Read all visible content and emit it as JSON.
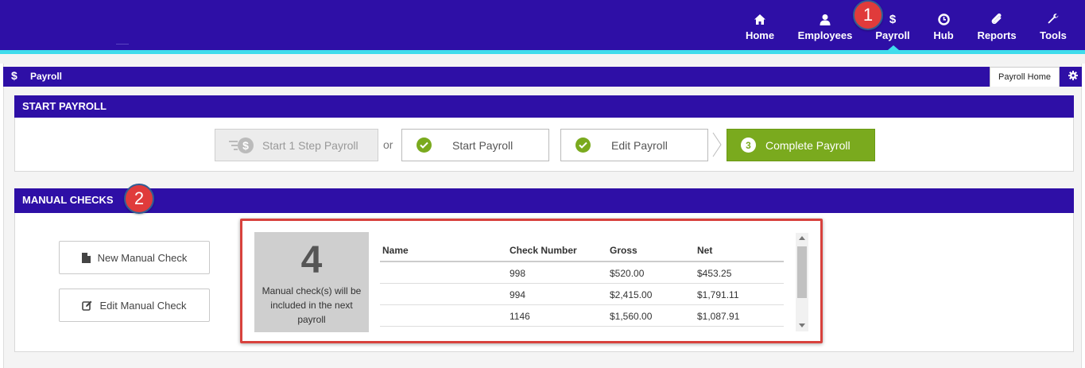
{
  "nav": {
    "items": [
      {
        "label": "Home",
        "icon": "home-icon"
      },
      {
        "label": "Employees",
        "icon": "user-icon"
      },
      {
        "label": "Payroll",
        "icon": "dollar-icon"
      },
      {
        "label": "Hub",
        "icon": "clock-icon"
      },
      {
        "label": "Reports",
        "icon": "paperclip-icon"
      },
      {
        "label": "Tools",
        "icon": "wrench-icon"
      }
    ],
    "active": "Payroll"
  },
  "annotations": {
    "badge1": "1",
    "badge2": "2"
  },
  "page": {
    "icon": "$",
    "title": "Payroll",
    "tab_label": "Payroll Home"
  },
  "start_payroll": {
    "heading": "START PAYROLL",
    "one_step_label": "Start 1 Step Payroll",
    "or_label": "or",
    "steps": [
      {
        "label": "Start Payroll",
        "status": "done"
      },
      {
        "label": "Edit Payroll",
        "status": "done"
      },
      {
        "label": "Complete Payroll",
        "status": "current",
        "number": "3"
      }
    ]
  },
  "manual_checks": {
    "heading": "MANUAL CHECKS",
    "new_label": "New Manual Check",
    "edit_label": "Edit Manual Check",
    "count": "4",
    "count_desc": "Manual check(s) will be included in the next payroll",
    "columns": [
      "Name",
      "Check Number",
      "Gross",
      "Net"
    ],
    "rows": [
      {
        "name": "",
        "check": "998",
        "gross": "$520.00",
        "net": "$453.25"
      },
      {
        "name": "",
        "check": "994",
        "gross": "$2,415.00",
        "net": "$1,791.11"
      },
      {
        "name": "",
        "check": "1146",
        "gross": "$1,560.00",
        "net": "$1,087.91"
      }
    ]
  },
  "colors": {
    "primary": "#2e0fa6",
    "accent": "#3fdcec",
    "success": "#7aaa1e",
    "annotation": "#e03b3b"
  }
}
